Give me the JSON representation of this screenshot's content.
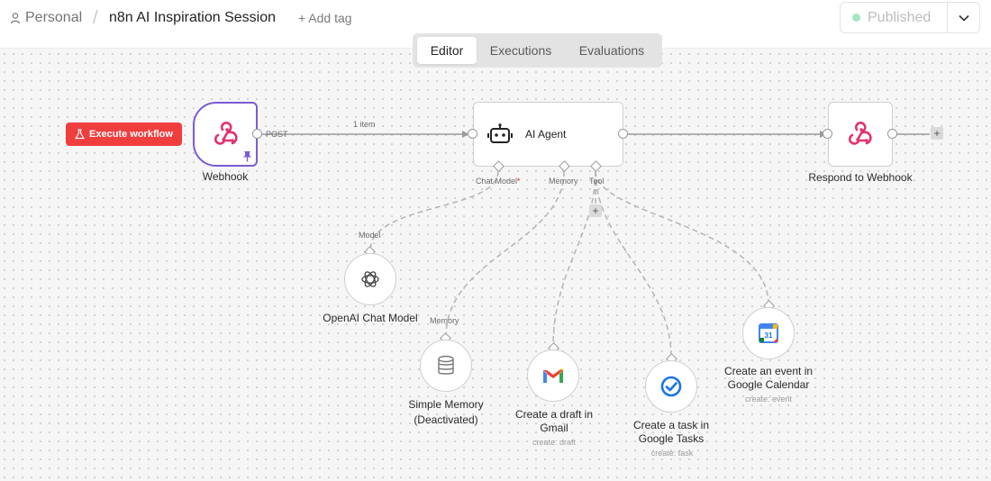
{
  "header": {
    "project": "Personal",
    "separator": "/",
    "workflow_title": "n8n AI Inspiration Session",
    "add_tag": "+ Add tag",
    "publish_label": "Published"
  },
  "tabs": [
    {
      "label": "Editor",
      "active": true
    },
    {
      "label": "Executions",
      "active": false
    },
    {
      "label": "Evaluations",
      "active": false
    }
  ],
  "canvas": {
    "execute_button": "Execute workflow",
    "edge_post_label": "POST",
    "edge_items_label": "1 item",
    "nodes": {
      "webhook": {
        "label": "Webhook",
        "icon": "webhook-icon"
      },
      "ai_agent": {
        "label": "AI Agent",
        "icon": "robot-icon"
      },
      "respond": {
        "label": "Respond to Webhook",
        "icon": "webhook-icon"
      },
      "openai": {
        "label": "OpenAI Chat Model",
        "icon": "openai-icon"
      },
      "memory": {
        "label": "Simple Memory (Deactivated)",
        "line1": "Simple Memory",
        "line2": "(Deactivated)",
        "icon": "database-icon"
      },
      "gmail": {
        "line1": "Create a draft in",
        "line2": "Gmail",
        "sub": "create: draft",
        "icon": "gmail-icon"
      },
      "tasks": {
        "line1": "Create a task in",
        "line2": "Google Tasks",
        "sub": "create: task",
        "icon": "google-tasks-icon"
      },
      "calendar": {
        "line1": "Create an event in",
        "line2": "Google Calendar",
        "sub": "create: event",
        "icon": "google-calendar-icon",
        "calendar_day": "31"
      }
    },
    "ports": {
      "chat_model": "Chat Model",
      "required_mark": "*",
      "memory": "Memory",
      "tool": "Tool",
      "model_in": "Model",
      "memory_in": "Memory"
    },
    "plus": "+"
  },
  "colors": {
    "accent_purple": "#7b5cd6",
    "execute_red": "#f03e3e",
    "published_green": "#a8e6c3",
    "webhook_pink": "#e5316b"
  }
}
